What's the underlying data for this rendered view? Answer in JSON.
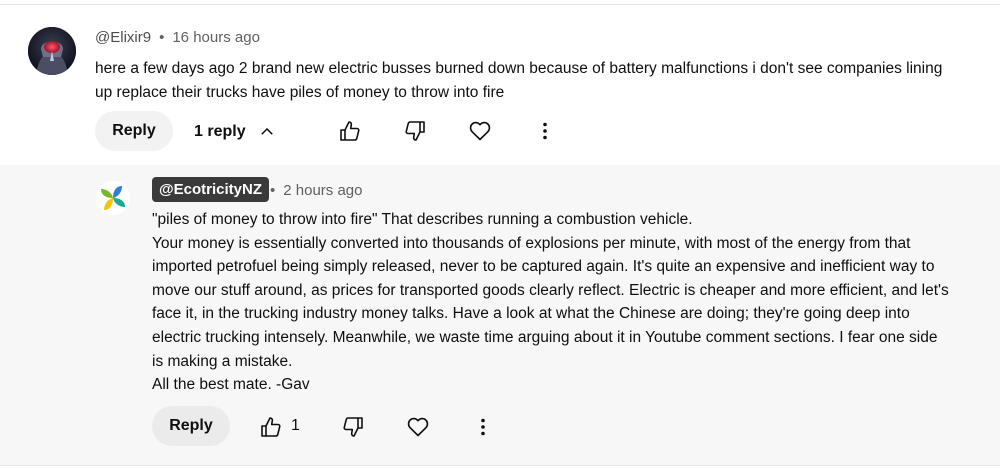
{
  "comment": {
    "author": "@Elixir9",
    "separator": "•",
    "time": "16 hours ago",
    "text": "here a few days ago 2 brand new electric busses burned down because of battery malfunctions i don't see companies lining up replace their trucks have piles of money to throw into fire",
    "reply_label": "Reply",
    "replies_toggle_label": "1 reply",
    "icons": [
      "thumb-up-icon",
      "thumb-down-icon",
      "heart-icon",
      "more-vertical-icon"
    ]
  },
  "reply": {
    "author": "@EcotricityNZ",
    "separator": "•",
    "time": "2 hours ago",
    "paragraphs": [
      "\"piles of money to throw into fire\" That describes running a combustion vehicle.",
      "Your money is essentially converted into thousands of explosions per minute, with most of the energy from that imported petrofuel being simply released, never to be captured again. It's quite an expensive and inefficient way to move our stuff around, as prices for transported goods clearly reflect. Electric is cheaper and more efficient, and let's face it, in the trucking industry money talks. Have a look at what the Chinese are doing; they're going deep into electric trucking intensely. Meanwhile, we waste time arguing about it in Youtube comment sections. I fear one side is making a mistake.",
      "All the best mate. -Gav"
    ],
    "reply_label": "Reply",
    "like_count": "1",
    "icons": [
      "thumb-up-icon",
      "thumb-down-icon",
      "heart-icon",
      "more-vertical-icon"
    ]
  },
  "colors": {
    "panel_bg": "#f7f7f7",
    "secondary_text": "#606060",
    "author_badge_bg": "#3a3a3a",
    "pinwheel": [
      "#2f7fd0",
      "#76b82a",
      "#f4c20d",
      "#1aa89a"
    ]
  }
}
